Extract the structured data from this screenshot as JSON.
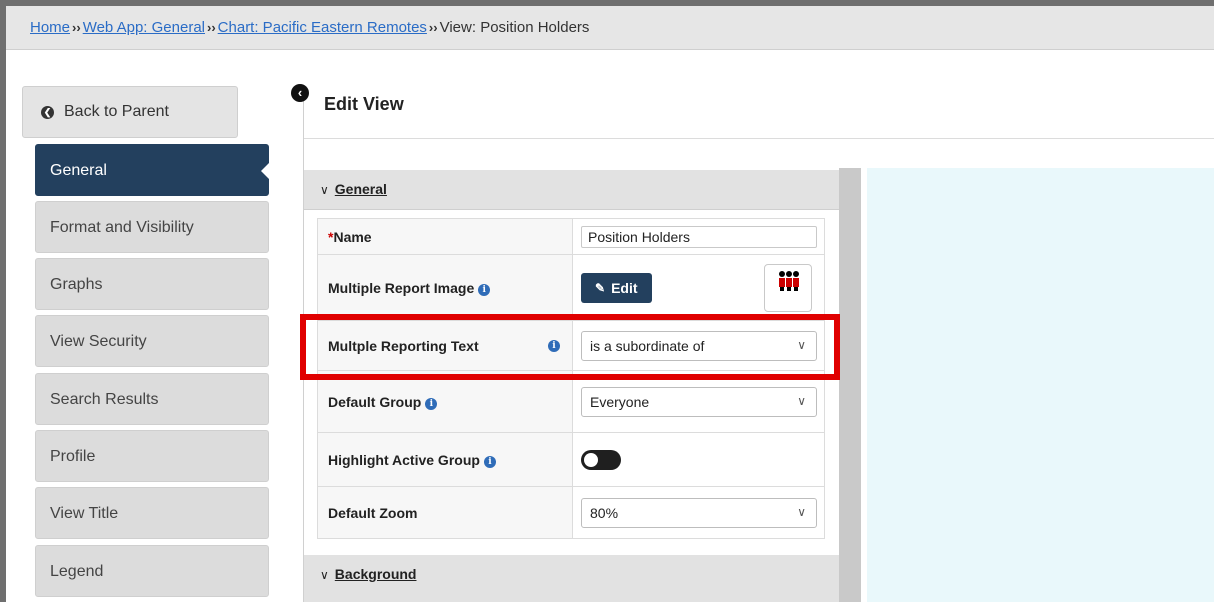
{
  "breadcrumb": {
    "home": "Home",
    "sep": "››",
    "web_app": "Web App: General",
    "chart": "Chart: Pacific Eastern Remotes",
    "view_label": "View:",
    "view_name": "Position Holders"
  },
  "sidebar": {
    "back_label": "Back to Parent",
    "items": [
      {
        "label": "General",
        "active": true
      },
      {
        "label": "Format and Visibility"
      },
      {
        "label": "Graphs"
      },
      {
        "label": "View Security"
      },
      {
        "label": "Search Results"
      },
      {
        "label": "Profile"
      },
      {
        "label": "View Title"
      },
      {
        "label": "Legend"
      }
    ]
  },
  "main": {
    "title": "Edit View",
    "sections": {
      "general": "General",
      "background": "Background"
    },
    "fields": {
      "name_label": "Name",
      "name_value": "Position Holders",
      "multi_image_label": "Multiple Report Image",
      "edit_label": "Edit",
      "multi_text_label": "Multple Reporting Text",
      "multi_text_value": "is a subordinate of",
      "default_group_label": "Default Group",
      "default_group_value": "Everyone",
      "highlight_label": "Highlight Active Group",
      "highlight_on": true,
      "zoom_label": "Default Zoom",
      "zoom_value": "80%"
    }
  },
  "colors": {
    "accent": "#23405e",
    "link": "#2a6cc6",
    "highlight_box": "#e00000",
    "preview_bg": "#e9f8fb"
  }
}
